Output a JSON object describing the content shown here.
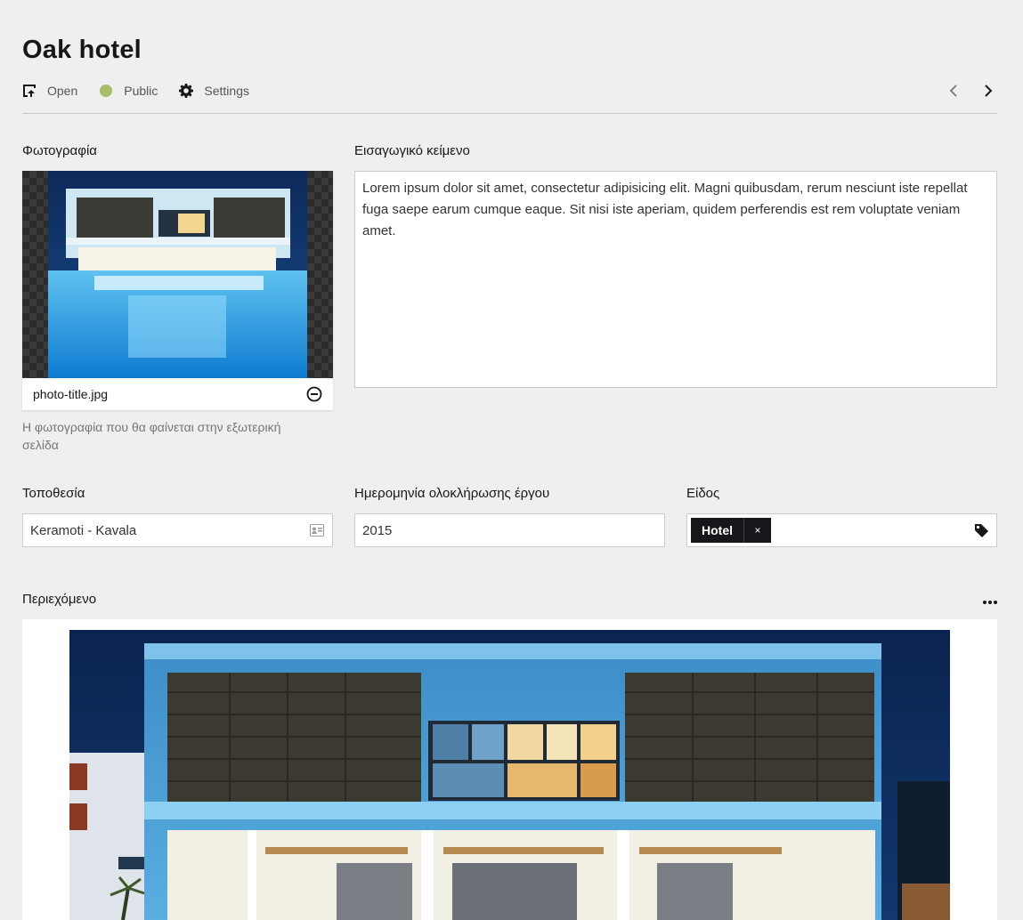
{
  "page": {
    "title": "Oak hotel"
  },
  "toolbar": {
    "open_label": "Open",
    "status_label": "Public",
    "status_color": "#a7bd68",
    "settings_label": "Settings",
    "open_icon": "open-external-icon",
    "settings_icon": "gear-icon",
    "prev_icon": "chevron-left-icon",
    "next_icon": "chevron-right-icon"
  },
  "photo": {
    "label": "Φωτογραφία",
    "filename": "photo-title.jpg",
    "help": "Η φωτογραφία που θα φαίνεται στην εξωτερική σελίδα"
  },
  "intro": {
    "label": "Εισαγωγικό κείμενο",
    "value": "Lorem ipsum dolor sit amet, consectetur adipisicing elit. Magni quibusdam, rerum nesciunt iste repellat fuga saepe earum cumque eaque. Sit nisi iste aperiam, quidem perferendis est rem voluptate veniam amet."
  },
  "location": {
    "label": "Τοποθεσία",
    "value": "Keramoti - Kavala"
  },
  "completion": {
    "label": "Ημερομηνία ολοκλήρωσης έργου",
    "value": "2015"
  },
  "type": {
    "label": "Είδος",
    "tag": "Hotel",
    "tag_remove": "×"
  },
  "content": {
    "label": "Περιεχόμενο"
  }
}
